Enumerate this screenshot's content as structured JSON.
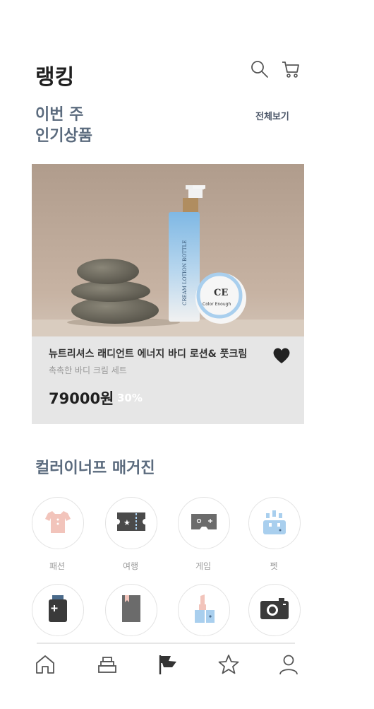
{
  "header": {
    "title": "랭킹",
    "search_icon": "search-icon",
    "cart_icon": "cart-icon"
  },
  "weekly": {
    "title_line1": "이번 주",
    "title_line2": "인기상품",
    "see_all": "전체보기"
  },
  "product": {
    "name": "뉴트리셔스 래디언트 에너지 바디 로션& 풋크림",
    "description": "촉촉한 바디 크림 세트",
    "price": "79000원",
    "discount": "30%",
    "bottle_text": "CREAM LOTION BOTTLE",
    "jar_logo": "CE",
    "jar_text": "Color Enough",
    "liked": true
  },
  "magazine": {
    "title": "컬러이너프 매거진",
    "categories": [
      {
        "label": "패션",
        "icon": "shirt-icon"
      },
      {
        "label": "여행",
        "icon": "ticket-icon"
      },
      {
        "label": "게임",
        "icon": "gamepad-icon"
      },
      {
        "label": "펫",
        "icon": "pet-icon"
      },
      {
        "label": "",
        "icon": "medicine-bottle-icon"
      },
      {
        "label": "",
        "icon": "book-icon"
      },
      {
        "label": "",
        "icon": "cosmetics-icon"
      },
      {
        "label": "",
        "icon": "camera-icon"
      }
    ]
  },
  "bottom_nav": [
    {
      "icon": "home-icon"
    },
    {
      "icon": "layers-icon"
    },
    {
      "icon": "flag-icon",
      "active": true
    },
    {
      "icon": "star-icon"
    },
    {
      "icon": "user-icon"
    }
  ],
  "colors": {
    "accent_gray_blue": "#5b6b7e",
    "card_bg": "#e6e6e6",
    "pink": "#f2c4bb",
    "light_blue": "#a9cfee",
    "dark_icon": "#4a4a4a"
  }
}
